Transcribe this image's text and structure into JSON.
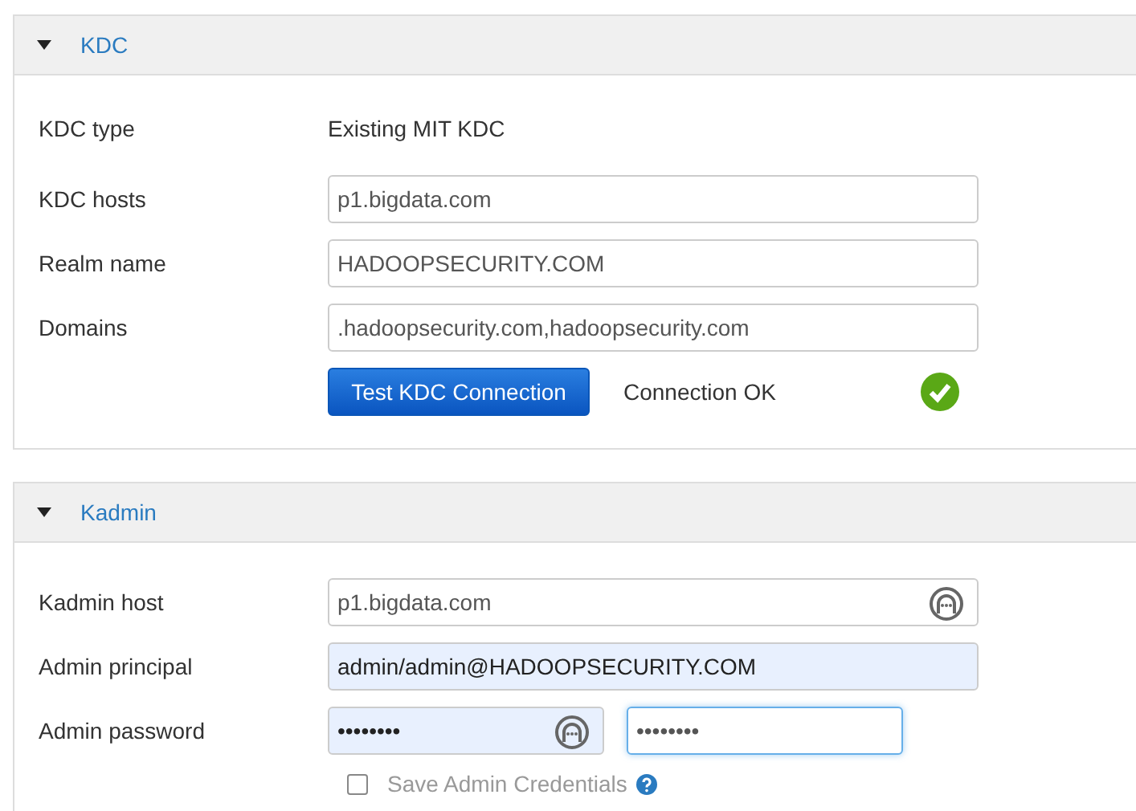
{
  "panels": [
    {
      "title": "KDC",
      "expanded": true,
      "rows": [
        {
          "kind": "static",
          "label": "KDC type",
          "value": "Existing MIT KDC"
        },
        {
          "kind": "text",
          "label": "KDC hosts",
          "value": "p1.bigdata.com",
          "autofilled": false,
          "manager_icon": false
        },
        {
          "kind": "text",
          "label": "Realm name",
          "value": "HADOOPSECURITY.COM",
          "autofilled": false,
          "manager_icon": false
        },
        {
          "kind": "text",
          "label": "Domains",
          "value": ".hadoopsecurity.com,hadoopsecurity.com",
          "autofilled": false,
          "manager_icon": false
        },
        {
          "kind": "test",
          "button": "Test KDC Connection",
          "status": "Connection OK",
          "ok": true
        }
      ]
    },
    {
      "title": "Kadmin",
      "expanded": true,
      "rows": [
        {
          "kind": "text",
          "label": "Kadmin host",
          "value": "p1.bigdata.com",
          "autofilled": false,
          "manager_icon": true
        },
        {
          "kind": "text",
          "label": "Admin principal",
          "value": "admin/admin@HADOOPSECURITY.COM",
          "autofilled": true,
          "manager_icon": false
        },
        {
          "kind": "password",
          "label": "Admin password",
          "fields": [
            {
              "value": "••••••••",
              "autofilled": true,
              "manager_icon": true,
              "focused": false
            },
            {
              "value": "••••••••",
              "autofilled": false,
              "manager_icon": false,
              "focused": true
            }
          ]
        },
        {
          "kind": "checkbox",
          "label": "Save Admin Credentials",
          "checked": false,
          "help": true
        }
      ]
    }
  ]
}
